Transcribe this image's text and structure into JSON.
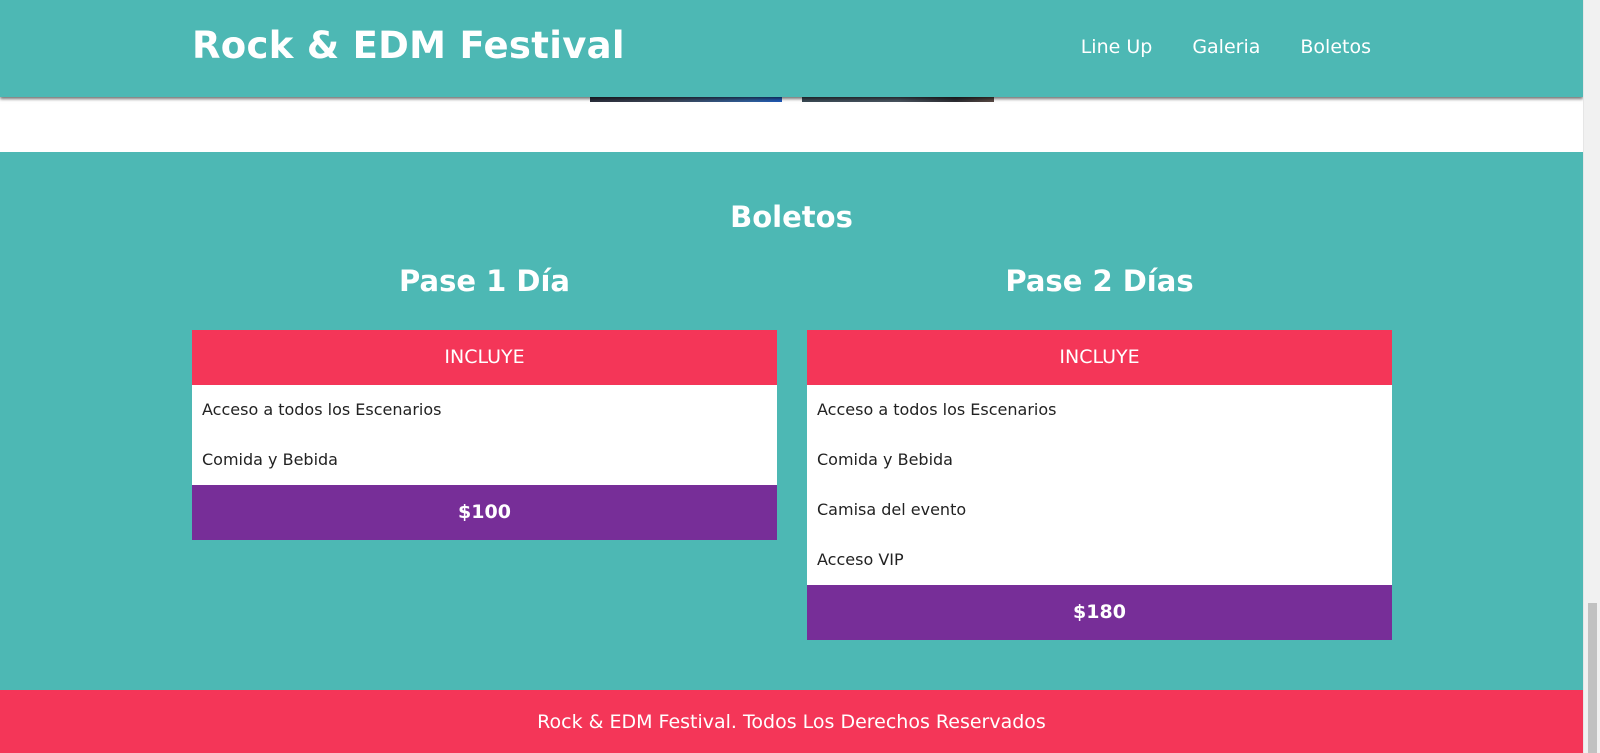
{
  "header": {
    "title": "Rock & EDM Festival",
    "nav": [
      "Line Up",
      "Galeria",
      "Boletos"
    ]
  },
  "tickets": {
    "title": "Boletos",
    "passes": [
      {
        "name": "Pase 1 Día",
        "includes_label": "INCLUYE",
        "features": [
          "Acceso a todos los Escenarios",
          "Comida y Bebida"
        ],
        "price": "$100"
      },
      {
        "name": "Pase 2 Días",
        "includes_label": "INCLUYE",
        "features": [
          "Acceso a todos los Escenarios",
          "Comida y Bebida",
          "Camisa del evento",
          "Acceso VIP"
        ],
        "price": "$180"
      }
    ]
  },
  "footer": {
    "text": "Rock & EDM Festival. Todos Los Derechos Reservados"
  },
  "colors": {
    "teal": "#4db8b4",
    "pink": "#f43658",
    "purple": "#772e98",
    "white": "#ffffff"
  }
}
